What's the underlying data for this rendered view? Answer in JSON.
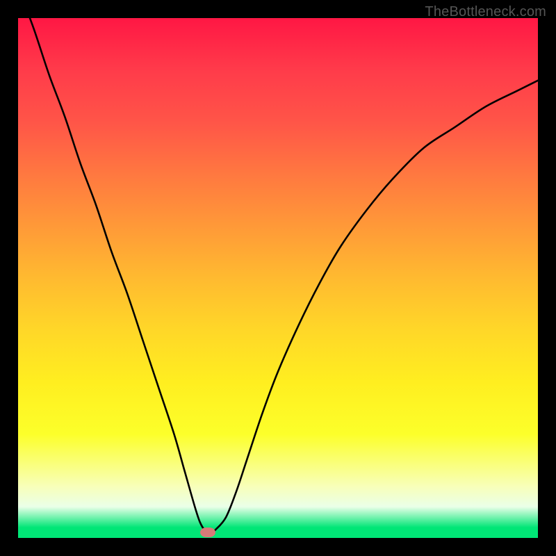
{
  "watermark": "TheBottleneck.com",
  "chart_data": {
    "type": "line",
    "title": "",
    "xlabel": "",
    "ylabel": "",
    "xlim": [
      0,
      100
    ],
    "ylim": [
      0,
      100
    ],
    "series": [
      {
        "name": "curve",
        "x": [
          0,
          3,
          6,
          9,
          12,
          15,
          18,
          21,
          24,
          27,
          30,
          32,
          34,
          35,
          36,
          37,
          38,
          40,
          42,
          44,
          47,
          50,
          54,
          58,
          62,
          67,
          72,
          78,
          84,
          90,
          96,
          100
        ],
        "values": [
          106,
          98,
          89,
          81,
          72,
          64,
          55,
          47,
          38,
          29,
          20,
          13,
          6,
          3,
          1.4,
          1.0,
          1.6,
          4,
          9,
          15,
          24,
          32,
          41,
          49,
          56,
          63,
          69,
          75,
          79,
          83,
          86,
          88
        ]
      }
    ],
    "marker": {
      "x": 36.5,
      "y": 1.1
    },
    "gradient_stops": [
      {
        "pos": 0,
        "color": "#ff1744"
      },
      {
        "pos": 50,
        "color": "#ffd728"
      },
      {
        "pos": 90,
        "color": "#f8ffb8"
      },
      {
        "pos": 100,
        "color": "#00e676"
      }
    ]
  }
}
